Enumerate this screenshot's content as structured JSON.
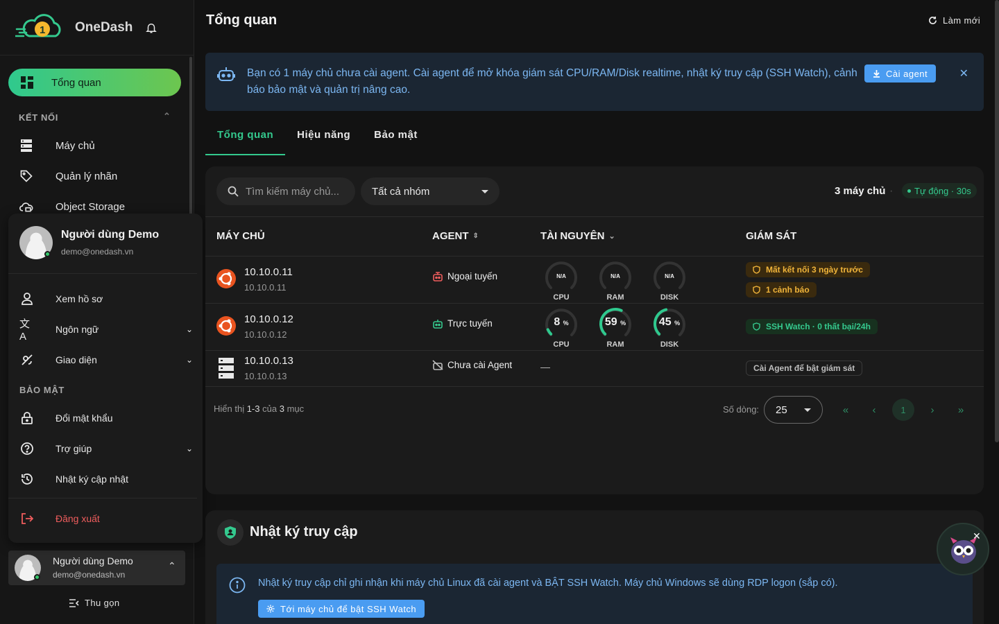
{
  "brand": {
    "name": "OneDash"
  },
  "nav": {
    "active": "Tổng quan",
    "section": "KẾT NỐI",
    "items": [
      "Máy chủ",
      "Quản lý nhãn",
      "Object Storage"
    ]
  },
  "user_menu": {
    "name": "Người dùng Demo",
    "email": "demo@onedash.vn",
    "items": [
      "Xem hồ sơ",
      "Ngôn ngữ",
      "Giao diện"
    ],
    "security_title": "BẢO MẬT",
    "security_items": [
      "Đổi mật khẩu",
      "Trợ giúp",
      "Nhật ký cập nhật"
    ],
    "logout": "Đăng xuất"
  },
  "user_card": {
    "name": "Người dùng Demo",
    "email": "demo@onedash.vn"
  },
  "collapse_label": "Thu gọn",
  "header": {
    "title": "Tổng quan",
    "refresh": "Làm mới"
  },
  "banner": {
    "text": "Bạn có 1 máy chủ chưa cài agent. Cài agent để mở khóa giám sát CPU/RAM/Disk realtime, nhật ký truy cập (SSH Watch), cảnh báo bảo mật và quản trị nâng cao.",
    "button": "Cài agent"
  },
  "tabs": [
    "Tổng quan",
    "Hiệu năng",
    "Bảo mật"
  ],
  "toolbar": {
    "search_placeholder": "Tìm kiếm máy chủ...",
    "group_select": "Tất cả nhóm",
    "count": "3 máy chủ",
    "auto": "Tự động · 30s"
  },
  "table": {
    "headers": [
      "MÁY CHỦ",
      "AGENT",
      "TÀI NGUYÊN",
      "GIÁM SÁT"
    ],
    "gauge_labels": [
      "CPU",
      "RAM",
      "DISK"
    ],
    "rows": [
      {
        "ip": "10.10.0.11",
        "sub": "10.10.0.11",
        "agent": "Ngoại tuyến",
        "cpu": "N/A",
        "ram": "N/A",
        "disk": "N/A",
        "badges": [
          "Mất kết nối 3 ngày trước",
          "1 cảnh báo"
        ]
      },
      {
        "ip": "10.10.0.12",
        "sub": "10.10.0.12",
        "agent": "Trực tuyến",
        "cpu": "8",
        "ram": "59",
        "disk": "45",
        "badges": [
          "SSH Watch · 0 thất bại/24h"
        ]
      },
      {
        "ip": "10.10.0.13",
        "sub": "10.10.0.13",
        "agent": "Chưa cài Agent",
        "resources": "—",
        "badges": [
          "Cài Agent để bật giám sát"
        ]
      }
    ],
    "gauge_values": {
      "row2": [
        8,
        59,
        45
      ]
    },
    "percent_sign": "%"
  },
  "footer": {
    "prefix": "Hiển thị",
    "range": "1-3",
    "of": "của",
    "total": "3",
    "suffix": "mục",
    "rows_label": "Số dòng:",
    "rows_value": "25",
    "page": "1"
  },
  "access_log": {
    "title": "Nhật ký truy cập",
    "info": "Nhật ký truy cập chỉ ghi nhận khi máy chủ Linux đã cài agent và BẬT SSH Watch. Máy chủ Windows sẽ dùng RDP logon (sắp có).",
    "button": "Tới máy chủ để bật SSH Watch"
  },
  "colors": {
    "accent": "#34c98e",
    "info": "#4a9cf1",
    "warn": "#f0b43a",
    "danger": "#ef5d5d"
  }
}
